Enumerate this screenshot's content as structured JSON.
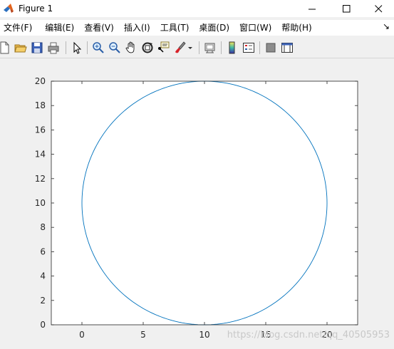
{
  "window": {
    "title": "Figure 1",
    "controls": {
      "minimize": "—",
      "maximize": "☐",
      "close": "✕"
    }
  },
  "menu": {
    "items": [
      "文件(F)",
      "编辑(E)",
      "查看(V)",
      "插入(I)",
      "工具(T)",
      "桌面(D)",
      "窗口(W)",
      "帮助(H)"
    ],
    "overflow": "↘"
  },
  "toolbar": {
    "buttons": [
      "new-figure-icon",
      "open-file-icon",
      "save-icon",
      "print-icon",
      "edit-plot-icon",
      "zoom-in-icon",
      "zoom-out-icon",
      "pan-icon",
      "rotate-3d-icon",
      "data-cursor-icon",
      "brush-icon",
      "link-plot-icon",
      "colorbar-icon",
      "legend-icon",
      "hide-plot-tools-icon",
      "show-plot-tools-icon"
    ]
  },
  "watermark": "https://blog.csdn.net/qq_40505953",
  "chart_data": {
    "type": "line",
    "title": "",
    "xlabel": "",
    "ylabel": "",
    "xlim": [
      -2.5,
      22.5
    ],
    "ylim": [
      0,
      20
    ],
    "xticks": [
      0,
      5,
      10,
      15,
      20
    ],
    "yticks": [
      0,
      2,
      4,
      6,
      8,
      10,
      12,
      14,
      16,
      18,
      20
    ],
    "grid": false,
    "series": [
      {
        "shape": "circle",
        "center": [
          10,
          10
        ],
        "radius": 10,
        "color": "#0072bd"
      }
    ]
  }
}
